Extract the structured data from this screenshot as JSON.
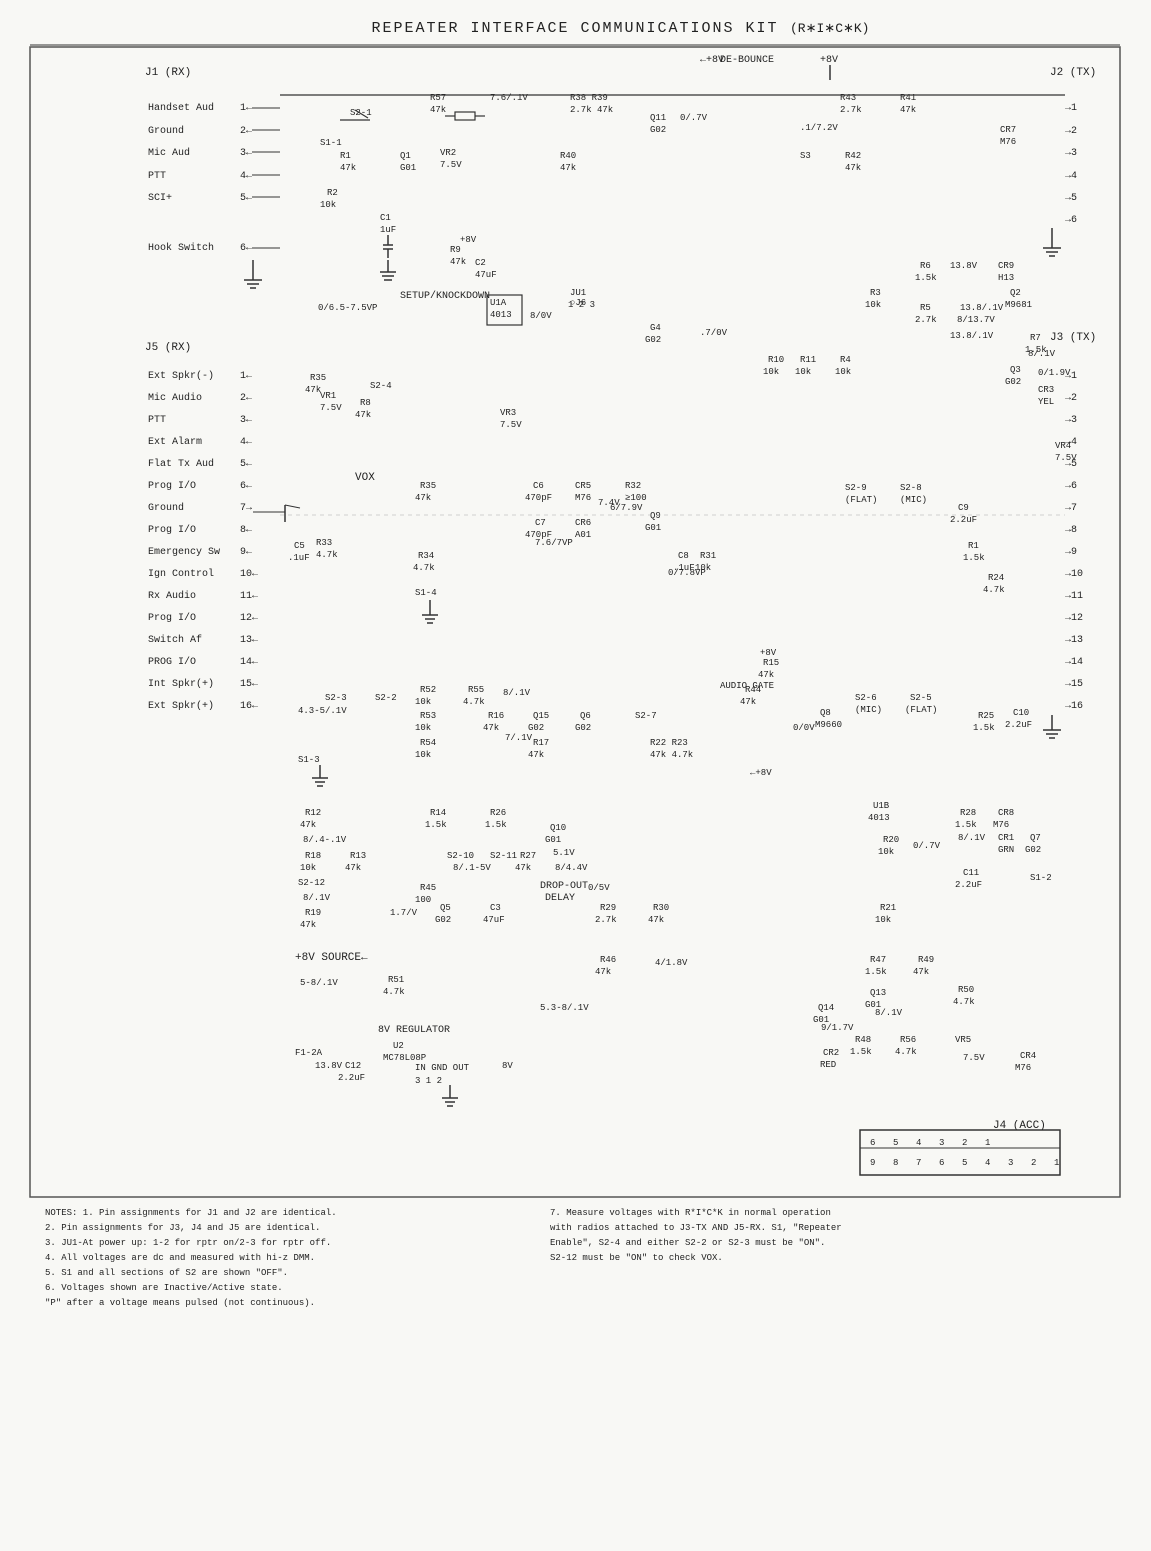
{
  "title": {
    "main": "REPEATER INTERFACE COMMUNICATIONS KIT",
    "subtitle": "(R*I*C*K)"
  },
  "connectors": {
    "j1_rx": "J1 (RX)",
    "j2_tx": "J2 (TX)",
    "j3_tx": "J3 (TX)",
    "j4_acc": "J4 (ACC)",
    "j5_rx": "J5 (RX)"
  },
  "j1_pins": [
    {
      "num": "1",
      "label": "Handset Aud"
    },
    {
      "num": "2",
      "label": "Ground"
    },
    {
      "num": "3",
      "label": "Mic Aud"
    },
    {
      "num": "4",
      "label": "PTT"
    },
    {
      "num": "5",
      "label": "SCI+"
    },
    {
      "num": "6",
      "label": "Hook Switch"
    }
  ],
  "j5_pins": [
    {
      "num": "1",
      "label": "Ext Spkr(-)"
    },
    {
      "num": "2",
      "label": "Mic Audio"
    },
    {
      "num": "3",
      "label": "PTT"
    },
    {
      "num": "4",
      "label": "Ext Alarm"
    },
    {
      "num": "5",
      "label": "Flat Tx Aud"
    },
    {
      "num": "6",
      "label": "Prog I/O"
    },
    {
      "num": "7",
      "label": "Ground"
    },
    {
      "num": "8",
      "label": "Prog I/O"
    },
    {
      "num": "9",
      "label": "Emergency Sw"
    },
    {
      "num": "10",
      "label": "Ign Control"
    },
    {
      "num": "11",
      "label": "Rx Audio"
    },
    {
      "num": "12",
      "label": "Prog I/O"
    },
    {
      "num": "13",
      "label": "Switch Af"
    },
    {
      "num": "14",
      "label": "PROG I/O"
    },
    {
      "num": "15",
      "label": "Int Spkr(+)"
    },
    {
      "num": "16",
      "label": "Ext Spkr(+)"
    }
  ],
  "notes": {
    "header": "NOTES:",
    "lines": [
      "1. Pin assignments for J1 and J2 are identical.",
      "2. Pin assignments for J3, J4 and J5 are identical.",
      "3. JU1-At power up: 1-2 for rptr on/2-3 for rptr off.",
      "4. All voltages are dc and measured with hi-z DMM.",
      "5. S1 and all sections of S2 are shown \"OFF\".",
      "6. Voltages shown are Inactive/Active state.",
      "   \"P\" after a voltage means pulsed (not continuous)."
    ],
    "lines_right": [
      "7. Measure voltages with R*I*C*K in normal operation",
      "   with radios attached to J3-TX AND J5-RX. S1, \"Repeater",
      "   Enable\", S2-4 and either S2-2 or S2-3 must be \"ON\".",
      "   S2-12 must be \"ON\" to check VOX."
    ]
  },
  "power_labels": {
    "plus8v": "+8V",
    "plus8v_source": "+8V SOURCE←",
    "vox": "VOX",
    "setup_knockdown": "SETUP/KNOCKDOWN",
    "de_bounce": "DE-BOUNCE",
    "dropout_delay": "DROP-OUT DELAY",
    "8v_regulator": "8V REGULATOR",
    "u2_mc78l08p": "U2\nMC78L08P",
    "f1_2a": "F1-2A",
    "audio_gate": "AUDIO GATE"
  }
}
